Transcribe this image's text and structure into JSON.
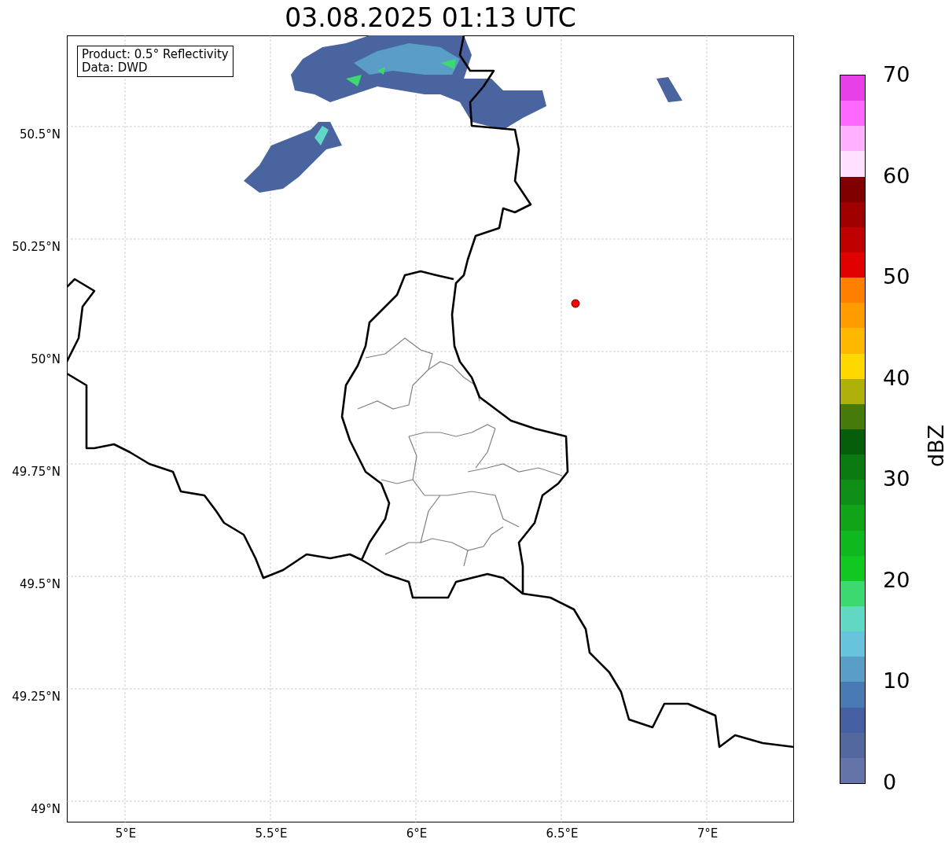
{
  "title": "03.08.2025 01:13 UTC",
  "legend": [
    "Product: 0.5° Reflectivity",
    "Data: DWD"
  ],
  "map": {
    "y_tick_labels": [
      "50.5°N",
      "50.25°N",
      "50°N",
      "49.75°N",
      "49.5°N",
      "49.25°N",
      "49°N"
    ],
    "x_tick_labels": [
      "5°E",
      "5.5°E",
      "6°E",
      "6.5°E",
      "7°E"
    ]
  },
  "colorbar": {
    "label": "dBZ",
    "ticks": [
      "70",
      "60",
      "50",
      "40",
      "30",
      "20",
      "10",
      "0"
    ],
    "segments": [
      {
        "color": "#6474a8"
      },
      {
        "color": "#5468a0"
      },
      {
        "color": "#4460a0"
      },
      {
        "color": "#4a7ab4"
      },
      {
        "color": "#5a9ec8"
      },
      {
        "color": "#68c4dc"
      },
      {
        "color": "#60d8c4"
      },
      {
        "color": "#3cd870"
      },
      {
        "color": "#10c820"
      },
      {
        "color": "#10b820"
      },
      {
        "color": "#10a418"
      },
      {
        "color": "#0e8e16"
      },
      {
        "color": "#0c7a12"
      },
      {
        "color": "#065e0a"
      },
      {
        "color": "#467a0a"
      },
      {
        "color": "#b0b00a"
      },
      {
        "color": "#ffd800"
      },
      {
        "color": "#ffb800"
      },
      {
        "color": "#ff9c00"
      },
      {
        "color": "#ff8000"
      },
      {
        "color": "#e00000"
      },
      {
        "color": "#c00000"
      },
      {
        "color": "#a00000"
      },
      {
        "color": "#800000"
      },
      {
        "color": "#ffe0ff"
      },
      {
        "color": "#ffb0ff"
      },
      {
        "color": "#ff68ff"
      },
      {
        "color": "#e840e8"
      }
    ]
  }
}
